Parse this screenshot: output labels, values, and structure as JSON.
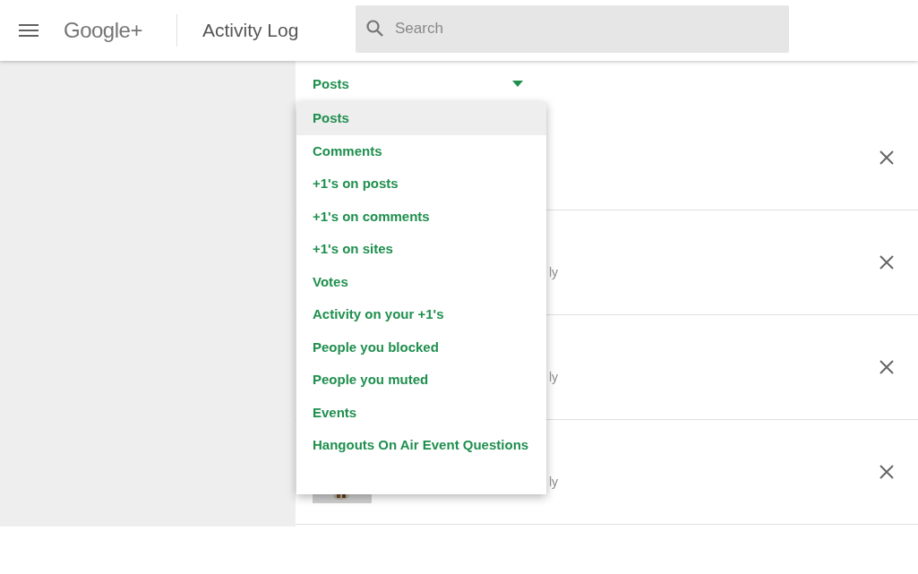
{
  "header": {
    "brand": "Google+",
    "title": "Activity Log",
    "search": {
      "placeholder": "Search"
    }
  },
  "filter": {
    "label": "Posts",
    "expanded": true
  },
  "dropdown": {
    "options": [
      {
        "label": "Posts",
        "selected": true
      },
      {
        "label": "Comments",
        "selected": false
      },
      {
        "label": "+1's on posts",
        "selected": false
      },
      {
        "label": "+1's on comments",
        "selected": false
      },
      {
        "label": "+1's on sites",
        "selected": false
      },
      {
        "label": "Votes",
        "selected": false
      },
      {
        "label": "Activity on your +1's",
        "selected": false
      },
      {
        "label": "People you blocked",
        "selected": false
      },
      {
        "label": "People you muted",
        "selected": false
      },
      {
        "label": "Events",
        "selected": false
      },
      {
        "label": "Hangouts On Air Event Questions",
        "selected": false
      }
    ]
  },
  "activity_rows": [
    {
      "kind": "plain"
    },
    {
      "kind": "plain",
      "snippet": "ly"
    },
    {
      "kind": "plain",
      "snippet": "ly"
    },
    {
      "kind": "thumbnail",
      "snippet": "ly"
    }
  ]
}
